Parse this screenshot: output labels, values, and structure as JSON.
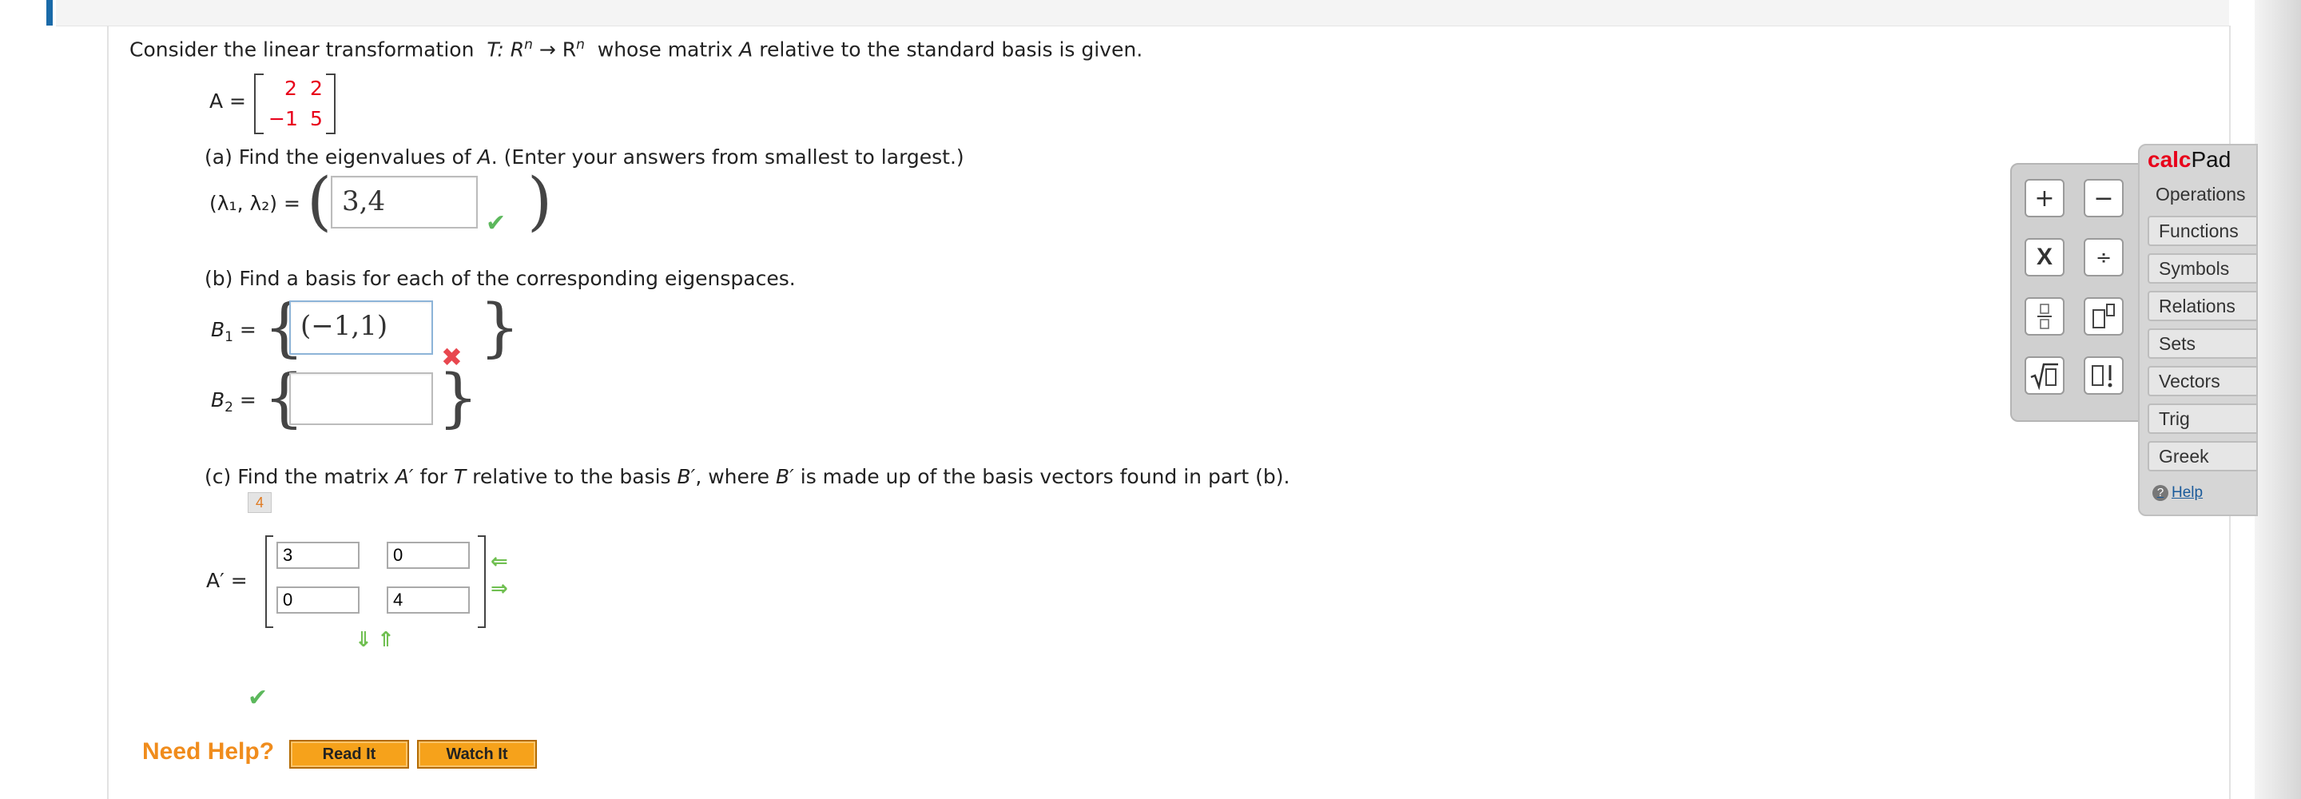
{
  "colors": {
    "accent_bar": "#1a6aa8",
    "help_orange": "#f08c1c",
    "red_mark": "#e8474f",
    "check_green": "#5cb85c"
  },
  "question": {
    "intro_prefix": "Consider the linear transformation",
    "intro_math": "T: R",
    "intro_n1": "n",
    "intro_arrow": "→ R",
    "intro_n2": "n",
    "intro_suffix": "whose matrix",
    "intro_A": "A",
    "intro_suffix2": "relative to the standard basis is given.",
    "matrix_label": "A =",
    "matrix": [
      [
        "2",
        "2"
      ],
      [
        "−1",
        "5"
      ]
    ]
  },
  "part_a": {
    "text": "(a) Find the eigenvalues of",
    "text_A": "A",
    "text_end": ". (Enter your answers from smallest to largest.)",
    "label": "(λ₁, λ₂) =",
    "answer": "3,4",
    "status_icon": "check-icon"
  },
  "part_b": {
    "text": "(b) Find a basis for each of the corresponding eigenspaces.",
    "b1_label": "B",
    "b1_sub": "1",
    "b1_answer": "(−1,1)",
    "b1_status": "x-icon",
    "b2_label": "B",
    "b2_sub": "2",
    "b2_answer": ""
  },
  "part_c": {
    "text_prefix": "(c) Find the matrix",
    "text_A": "A′",
    "text_mid1": "for",
    "text_T": "T",
    "text_mid2": "relative to the basis",
    "text_B": "B′",
    "text_mid3": ", where",
    "text_B2": "B′",
    "text_end": "is made up of the basis vectors found in part (b).",
    "attempts_badge": "4",
    "matrix_label": "A′ =",
    "cells": [
      "3",
      "0",
      "0",
      "4"
    ],
    "status_icon": "check-icon"
  },
  "help": {
    "label": "Need Help?",
    "read_it": "Read It",
    "watch_it": "Watch It"
  },
  "calcpad": {
    "title_calc": "calc",
    "title_pad": "Pad",
    "keys": [
      "+",
      "−",
      "X",
      "÷"
    ],
    "tabs": [
      "Operations",
      "Functions",
      "Symbols",
      "Relations",
      "Sets",
      "Vectors",
      "Trig",
      "Greek"
    ],
    "help": "Help"
  }
}
